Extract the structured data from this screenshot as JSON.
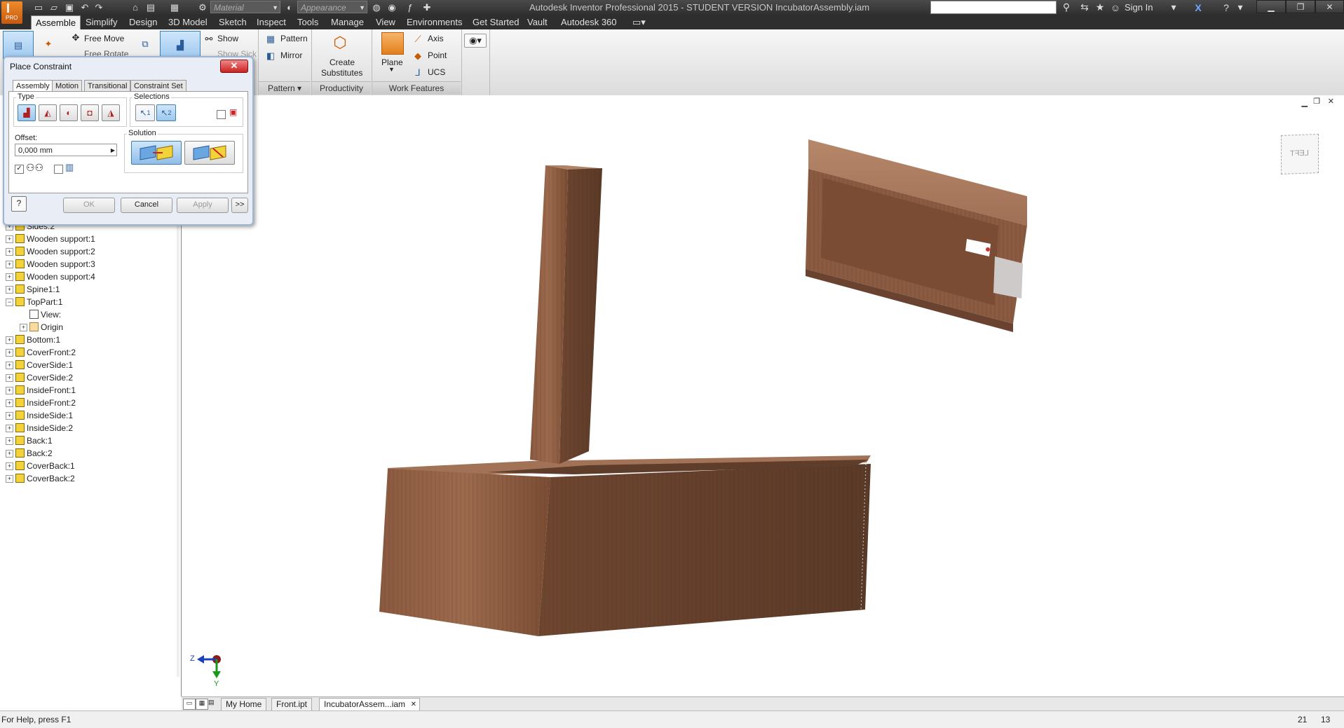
{
  "title_bar": {
    "app_title": "Autodesk Inventor Professional 2015 - STUDENT VERSION   IncubatorAssembly.iam",
    "material_combo": "Material",
    "appearance_combo": "Appearance",
    "app_badge": "PRO",
    "sign_in": "Sign In"
  },
  "ribbon_tabs": [
    "Assemble",
    "Simplify",
    "Design",
    "3D Model",
    "Sketch",
    "Inspect",
    "Tools",
    "Manage",
    "View",
    "Environments",
    "Get Started",
    "Vault",
    "Autodesk 360"
  ],
  "ribbon": {
    "free_move": "Free Move",
    "free_rotate": "Free Rotate",
    "show": "Show",
    "show_sick": "Show Sick",
    "pattern": "Pattern",
    "mirror": "Mirror",
    "pattern_panel": "Pattern",
    "create_substitutes_line1": "Create",
    "create_substitutes_line2": "Substitutes",
    "productivity_panel": "Productivity",
    "plane": "Plane",
    "axis": "Axis",
    "point": "Point",
    "ucs": "UCS",
    "work_features_panel": "Work Features"
  },
  "dialog": {
    "title": "Place Constraint",
    "tabs": [
      "Assembly",
      "Motion",
      "Transitional",
      "Constraint Set"
    ],
    "type_label": "Type",
    "selections_label": "Selections",
    "offset_label": "Offset:",
    "offset_value": "0,000 mm",
    "solution_label": "Solution",
    "ok": "OK",
    "cancel": "Cancel",
    "apply": "Apply",
    "more": ">>",
    "sel1": "1",
    "sel2": "2"
  },
  "browser_tree": [
    {
      "label": "Sides:2",
      "indent": 0
    },
    {
      "label": "Wooden support:1",
      "indent": 0
    },
    {
      "label": "Wooden support:2",
      "indent": 0
    },
    {
      "label": "Wooden support:3",
      "indent": 0
    },
    {
      "label": "Wooden support:4",
      "indent": 0
    },
    {
      "label": "Spine1:1",
      "indent": 0
    },
    {
      "label": "TopPart:1",
      "indent": 0
    },
    {
      "label": "View:",
      "indent": 1
    },
    {
      "label": "Origin",
      "indent": 1
    },
    {
      "label": "Bottom:1",
      "indent": 0
    },
    {
      "label": "CoverFront:2",
      "indent": 0
    },
    {
      "label": "CoverSide:1",
      "indent": 0
    },
    {
      "label": "CoverSide:2",
      "indent": 0
    },
    {
      "label": "InsideFront:1",
      "indent": 0
    },
    {
      "label": "InsideFront:2",
      "indent": 0
    },
    {
      "label": "InsideSide:1",
      "indent": 0
    },
    {
      "label": "InsideSide:2",
      "indent": 0
    },
    {
      "label": "Back:1",
      "indent": 0
    },
    {
      "label": "Back:2",
      "indent": 0
    },
    {
      "label": "CoverBack:1",
      "indent": 0
    },
    {
      "label": "CoverBack:2",
      "indent": 0
    }
  ],
  "viewcube_label": "LEFT",
  "axis_labels": {
    "z": "Z",
    "y": "Y"
  },
  "doc_tabs": [
    "My Home",
    "Front.ipt",
    "IncubatorAssem...iam"
  ],
  "status": {
    "help": "For Help, press F1",
    "num1": "21",
    "num2": "13"
  },
  "colors": {
    "wood_light": "#a3725a",
    "wood_dark": "#6e4630",
    "accent": "#3c7fb1"
  }
}
